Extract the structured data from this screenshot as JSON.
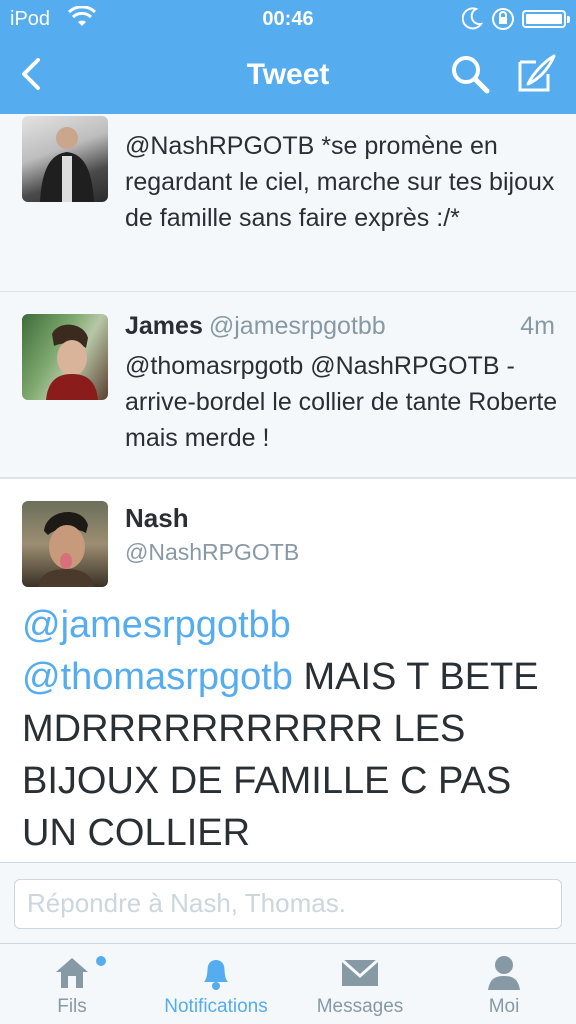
{
  "status_bar": {
    "carrier": "iPod",
    "time": "00:46"
  },
  "nav": {
    "title": "Tweet"
  },
  "tweets": [
    {
      "text": "@NashRPGOTB *se promène en regardant le ciel, marche sur tes bijoux de famille sans faire exprès :/*"
    },
    {
      "name": "James",
      "handle": "@jamesrpgotbb",
      "time": "4m",
      "text": "@thomasrpgotb @NashRPGOTB -arrive-bordel le collier de tante Roberte mais merde !"
    }
  ],
  "main_tweet": {
    "name": "Nash",
    "handle": "@NashRPGOTB",
    "mention_1": "@jamesrpgotbb",
    "mention_2": "@thomasrpgotb",
    "text": "MAIS T BETE MDRRRRRRRRRRR LES BIJOUX DE FAMILLE C PAS UN COLLIER"
  },
  "reply": {
    "placeholder": "Répondre à Nash, Thomas."
  },
  "tabs": [
    {
      "label": "Fils",
      "icon": "home-icon"
    },
    {
      "label": "Notifications",
      "icon": "bell-icon"
    },
    {
      "label": "Messages",
      "icon": "envelope-icon"
    },
    {
      "label": "Moi",
      "icon": "person-icon"
    }
  ],
  "colors": {
    "accent": "#55acee",
    "muted": "#8899a6",
    "text": "#292f33"
  }
}
